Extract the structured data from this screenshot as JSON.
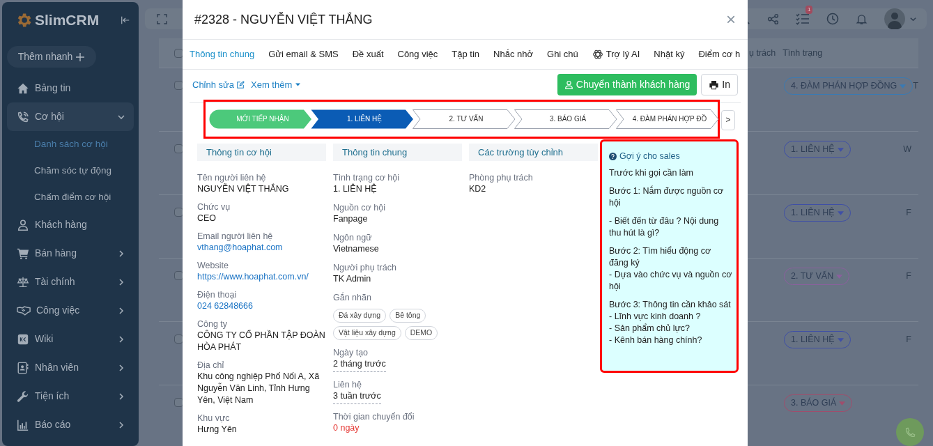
{
  "sidebar": {
    "brand": "SlimCRM",
    "quick_add": "Thêm nhanh",
    "items": [
      {
        "label": "Bảng tin",
        "kind": "link",
        "selected": false
      },
      {
        "label": "Cơ hội",
        "kind": "group",
        "selected": true,
        "expanded": true,
        "children": [
          {
            "label": "Danh sách cơ hội",
            "selected": true
          },
          {
            "label": "Chăm sóc tự động",
            "selected": false
          },
          {
            "label": "Chấm điểm cơ hội",
            "selected": false
          }
        ]
      },
      {
        "label": "Khách hàng",
        "kind": "link",
        "selected": false
      },
      {
        "label": "Bán hàng",
        "kind": "group",
        "selected": false,
        "expanded": false
      },
      {
        "label": "Tài chính",
        "kind": "group",
        "selected": false,
        "expanded": false
      },
      {
        "label": "Công việc",
        "kind": "group",
        "selected": false,
        "expanded": false
      },
      {
        "label": "Wiki",
        "kind": "group",
        "selected": false,
        "expanded": false
      },
      {
        "label": "Nhân viên",
        "kind": "group",
        "selected": false,
        "expanded": false
      },
      {
        "label": "Tiện ích",
        "kind": "group",
        "selected": false,
        "expanded": false
      },
      {
        "label": "Báo cáo",
        "kind": "group",
        "selected": false,
        "expanded": false
      }
    ]
  },
  "topbar": {
    "task_badge": "1"
  },
  "table": {
    "header_checked": false,
    "columns": [
      "ụ trách",
      "Tình trạng"
    ],
    "rows": [
      {
        "checked": false,
        "status": "4. ĐÀM PHÁN HỢP ĐỒNG",
        "color": "#3a7ab3",
        "column_3": "T"
      },
      {
        "checked": false,
        "status": "1. LIÊN HỆ",
        "color": "#3f4fa6",
        "column_3": "W"
      },
      {
        "checked": false,
        "status": "1. LIÊN HỆ",
        "color": "#3f4fa6",
        "column_3": "F"
      },
      {
        "checked": false,
        "status": "2. TƯ VẤN",
        "color": "#8c5f9e",
        "column_3": "F"
      },
      {
        "checked": false,
        "status": "1. LIÊN HỆ",
        "color": "#3f4fa6",
        "column_3": "F"
      },
      {
        "checked": false,
        "status": "3. BÁO GIÁ",
        "color": "#a04d6c"
      }
    ]
  },
  "modal": {
    "title": "#2328 - NGUYỄN VIỆT THẮNG",
    "close": "×",
    "tabs": [
      {
        "label": "Thông tin chung",
        "selected": true,
        "kind": "text"
      },
      {
        "label": "Gửi email & SMS",
        "selected": false,
        "kind": "text"
      },
      {
        "label": "Đề xuất",
        "selected": false,
        "kind": "text"
      },
      {
        "label": "Công việc",
        "selected": false,
        "kind": "text"
      },
      {
        "label": "Tập tin",
        "selected": false,
        "kind": "text"
      },
      {
        "label": "Nhắc nhở",
        "selected": false,
        "kind": "text"
      },
      {
        "label": "Ghi chú",
        "selected": false,
        "kind": "text"
      },
      {
        "label": "Trợ lý AI",
        "selected": false,
        "kind": "ai"
      },
      {
        "label": "Nhật ký",
        "selected": false,
        "kind": "text"
      },
      {
        "label": "Điểm cơ h",
        "selected": false,
        "kind": "text"
      }
    ],
    "edit_link": "Chỉnh sửa",
    "more_link": "Xem thêm",
    "convert_button": "Chuyển thành khách hàng",
    "print_button": "In",
    "pipeline": {
      "stages": [
        {
          "label": "MỚI TIẾP NHẬN",
          "completed": true,
          "selected": false
        },
        {
          "label": "1. LIÊN HỆ",
          "completed": false,
          "selected": true
        },
        {
          "label": "2. TƯ VẤN",
          "completed": false,
          "selected": false
        },
        {
          "label": "3. BÁO GIÁ",
          "completed": false,
          "selected": false
        },
        {
          "label": "4. ĐÀM PHÁN HỢP ĐỒ",
          "completed": false,
          "selected": false
        }
      ],
      "next_button": ">"
    },
    "sections": [
      {
        "title": "Thông tin cơ hội",
        "fields": [
          {
            "label": "Tên người liên hệ",
            "value": "NGUYỄN VIỆT THẮNG",
            "kind": "text"
          },
          {
            "label": "Chức vụ",
            "value": "CEO",
            "kind": "text"
          },
          {
            "label": "Email người liên hệ",
            "value": "vthang@hoaphat.com",
            "kind": "link"
          },
          {
            "label": "Website",
            "value": "https://www.hoaphat.com.vn/",
            "kind": "link"
          },
          {
            "label": "Điện thoại",
            "value": "024 62848666",
            "kind": "link"
          },
          {
            "label": "Công ty",
            "value": "CÔNG TY CỔ PHẦN TẬP ĐOÀN HÒA PHÁT",
            "kind": "text"
          },
          {
            "label": "Địa chỉ",
            "value": "Khu công nghiệp Phố Nối A, Xã Nguyễn Văn Linh, Tỉnh Hưng Yên, Việt Nam",
            "kind": "text"
          },
          {
            "label": "Khu vực",
            "value": "Hưng Yên",
            "kind": "text"
          }
        ]
      },
      {
        "title": "Thông tin chung",
        "fields": [
          {
            "label": "Tình trạng cơ hội",
            "value": "1. LIÊN HỆ",
            "kind": "text"
          },
          {
            "label": "Nguồn cơ hội",
            "value": "Fanpage",
            "kind": "text"
          },
          {
            "label": "Ngôn ngữ",
            "value": "Vietnamese",
            "kind": "text"
          },
          {
            "label": "Người phụ trách",
            "value": "TK Admin",
            "kind": "text"
          },
          {
            "label": "Gắn nhãn",
            "kind": "tags",
            "tags": [
              "Đá xây dựng",
              "Bê tông",
              "Vật liệu xây dựng",
              "DEMO"
            ]
          },
          {
            "label": "Ngày tạo",
            "value": "2 tháng trước",
            "kind": "relative"
          },
          {
            "label": "Liên hệ",
            "value": "3 tuần trước",
            "kind": "relative"
          },
          {
            "label": "Thời gian chuyển đổi",
            "value": "0 ngày",
            "kind": "alert"
          }
        ]
      },
      {
        "title": "Các trường tùy chỉnh",
        "fields": [
          {
            "label": "Phòng phụ trách",
            "value": "KD2",
            "kind": "text"
          }
        ]
      }
    ],
    "hint": {
      "title": "Gợi ý cho sales",
      "blocks": [
        [
          "Trước khi gọi cần làm"
        ],
        [
          "Bước 1: Nắm được nguồn cơ hội"
        ],
        [
          "- Biết đến từ đâu ? Nội dung thu hút là gì?"
        ],
        [
          "Bước 2: Tìm hiểu động cơ đăng ký",
          "- Dựa vào chức vụ và nguồn cơ hội"
        ],
        [
          "Bước 3: Thông tin cần khảo sát",
          "- Lĩnh vực kinh doanh ?",
          "- Sản phẩm chủ lực?",
          "- Kênh bán hàng chính?"
        ]
      ]
    }
  }
}
